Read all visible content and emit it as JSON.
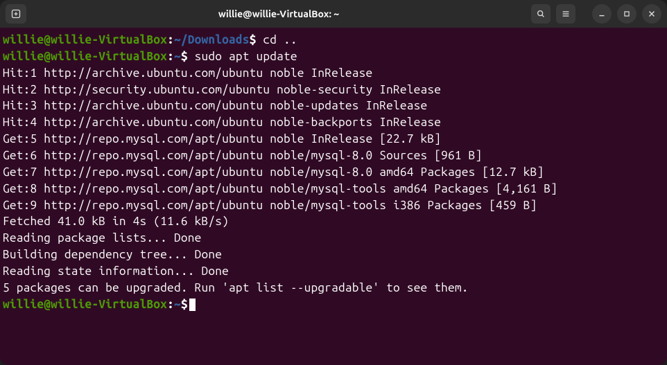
{
  "window": {
    "title": "willie@willie-VirtualBox: ~"
  },
  "icons": {
    "newtab": "new-tab-icon",
    "search": "search-icon",
    "menu": "hamburger-menu-icon",
    "minimize": "minimize-icon",
    "maximize": "maximize-icon",
    "close": "close-icon"
  },
  "terminal": {
    "prompts": [
      {
        "user": "willie@willie-VirtualBox",
        "path": "~/Downloads",
        "cmd": "cd .."
      },
      {
        "user": "willie@willie-VirtualBox",
        "path": "~",
        "cmd": "sudo apt update"
      }
    ],
    "output": [
      "Hit:1 http://archive.ubuntu.com/ubuntu noble InRelease",
      "Hit:2 http://security.ubuntu.com/ubuntu noble-security InRelease",
      "Hit:3 http://archive.ubuntu.com/ubuntu noble-updates InRelease",
      "Hit:4 http://archive.ubuntu.com/ubuntu noble-backports InRelease",
      "Get:5 http://repo.mysql.com/apt/ubuntu noble InRelease [22.7 kB]",
      "Get:6 http://repo.mysql.com/apt/ubuntu noble/mysql-8.0 Sources [961 B]",
      "Get:7 http://repo.mysql.com/apt/ubuntu noble/mysql-8.0 amd64 Packages [12.7 kB]",
      "Get:8 http://repo.mysql.com/apt/ubuntu noble/mysql-tools amd64 Packages [4,161 B]",
      "Get:9 http://repo.mysql.com/apt/ubuntu noble/mysql-tools i386 Packages [459 B]",
      "Fetched 41.0 kB in 4s (11.6 kB/s)",
      "Reading package lists... Done",
      "Building dependency tree... Done",
      "Reading state information... Done",
      "5 packages can be upgraded. Run 'apt list --upgradable' to see them."
    ],
    "final_prompt": {
      "user": "willie@willie-VirtualBox",
      "path": "~"
    }
  }
}
